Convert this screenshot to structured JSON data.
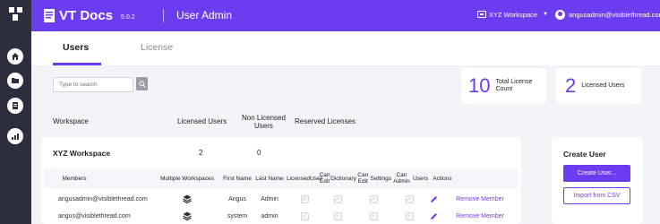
{
  "app": {
    "name": "VT Docs",
    "version": "5.0.2",
    "section": "User Admin"
  },
  "topbar": {
    "workspace_label": "XYZ Workspace",
    "user_email": "angusadmin@visiblethread.com"
  },
  "tabs": [
    {
      "label": "Users",
      "active": true
    },
    {
      "label": "License",
      "active": false
    }
  ],
  "search": {
    "placeholder": "Type to search"
  },
  "stats": {
    "total": {
      "value": "10",
      "label_line1": "Total License",
      "label_line2": "Count"
    },
    "licensed": {
      "value": "2",
      "label": "Licensed Users"
    }
  },
  "workspace_headers": {
    "workspace": "Workspace",
    "licensed": "Licensed Users",
    "non_licensed_1": "Non Licensed",
    "non_licensed_2": "Users",
    "reserved": "Reserved Licenses"
  },
  "workspace": {
    "name": "XYZ Workspace",
    "licensed_users": "2",
    "non_licensed_users": "0",
    "columns": {
      "members": "Members",
      "multiple_workspaces": "Multiple Workspaces",
      "first_name": "First Name",
      "last_name": "Last Name",
      "licensed_user_1": "Licensed",
      "licensed_user_2": "User",
      "can_edit_dict_1": "Can Edit",
      "can_edit_dict_2": "Dictionary",
      "can_edit_settings_1": "Can Edit",
      "can_edit_settings_2": "Settings",
      "can_admin_users_1": "Can Admin",
      "can_admin_users_2": "Users",
      "actions": "Actions"
    },
    "members": [
      {
        "email": "angusadmin@visiblethread.com",
        "first_name": "Angus",
        "last_name": "Admin",
        "action": "Remove Member"
      },
      {
        "email": "angus@visiblethread.com",
        "first_name": "system",
        "last_name": "admin",
        "action": "Remove Member"
      }
    ]
  },
  "create_user": {
    "title": "Create User",
    "create_button": "Create User...",
    "import_button": "Import from CSV"
  },
  "colors": {
    "accent": "#6c3cf0",
    "rail": "#2b2e3d",
    "background": "#f3f4f8"
  },
  "icons": [
    "app-logo-icon",
    "home-icon",
    "folder-icon",
    "document-icon",
    "chart-icon",
    "search-icon",
    "workspace-icon",
    "avatar-icon",
    "layers-icon",
    "pencil-icon",
    "check-icon"
  ]
}
